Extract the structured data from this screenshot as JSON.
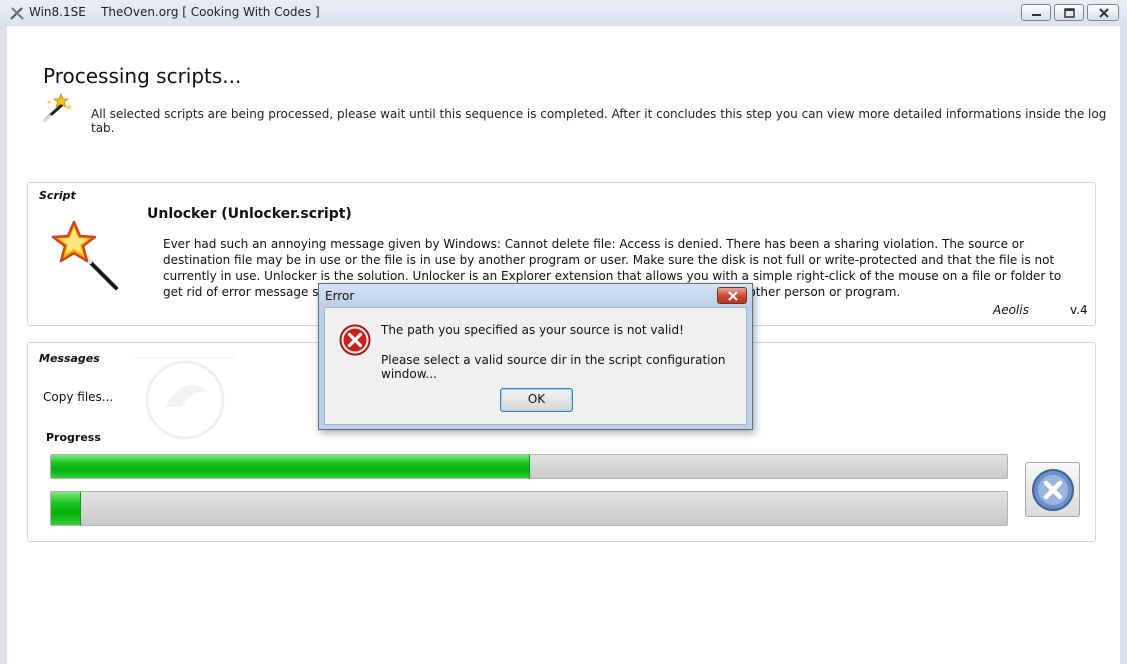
{
  "window": {
    "title": "Win8.1SE    TheOven.org [ Cooking With Codes ]"
  },
  "header": {
    "title": "Processing scripts...",
    "description": "All selected scripts are being processed, please wait until this sequence is completed. After it concludes this step you can view more detailed informations inside the log tab.",
    "icon": "magic-wand-icon"
  },
  "script_panel": {
    "caption": "Script",
    "name": "Unlocker (Unlocker.script)",
    "description": "Ever had such an annoying message given by Windows: Cannot delete file: Access is denied. There has been a sharing violation. The source or destination file may be in use or the file is in use by another program or user. Make sure the disk is not full or write-protected and that the file is not currently in use. Unlocker is the solution. Unlocker is an Explorer extension that allows you with a simple right-click of the mouse on a file or folder to get rid of error message such as error deleting file or folder, cannot delete folder: it is used by another person or program.",
    "author": "Aeolis",
    "version": "v.4",
    "icon": "star-wand-icon"
  },
  "messages_panel": {
    "caption": "Messages",
    "message": "Copy files...",
    "progress_label": "Progress",
    "progress": [
      0.5,
      0.03
    ],
    "cancel_icon": "cancel-x-icon"
  },
  "error_dialog": {
    "title": "Error",
    "message_line1": "The path you specified as your source is not valid!",
    "message_line2": "Please select a valid source dir in the script configuration window...",
    "ok_label": "OK",
    "icon": "error-icon"
  },
  "colors": {
    "progress_green": "#06b00c",
    "track_gray": "#c9c9c9",
    "dialog_frame": "#bcd0e8"
  }
}
